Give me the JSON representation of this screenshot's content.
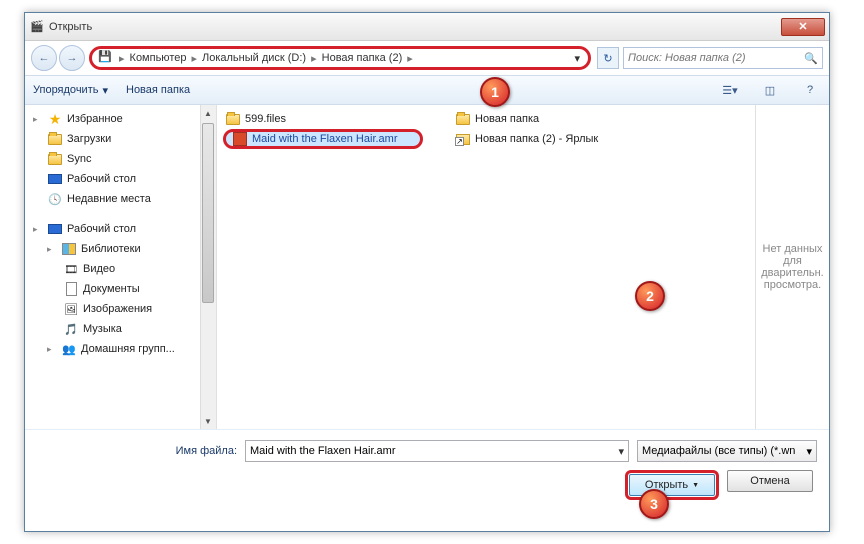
{
  "window": {
    "title": "Открыть"
  },
  "breadcrumb": {
    "parts": [
      "Компьютер",
      "Локальный диск (D:)",
      "Новая папка (2)"
    ]
  },
  "search": {
    "placeholder": "Поиск: Новая папка (2)"
  },
  "toolbar": {
    "organize": "Упорядочить",
    "newfolder": "Новая папка"
  },
  "sidebar": {
    "favorites": "Избранное",
    "downloads": "Загрузки",
    "sync": "Sync",
    "desktop": "Рабочий стол",
    "recent": "Недавние места",
    "desktop2": "Рабочий стол",
    "libraries": "Библиотеки",
    "video": "Видео",
    "documents": "Документы",
    "pictures": "Изображения",
    "music": "Музыка",
    "homegroup": "Домашняя групп..."
  },
  "files": {
    "f1": "599.files",
    "f2": "Maid with the Flaxen Hair.amr",
    "f3": "Новая папка",
    "f4": "Новая папка (2) - Ярлык"
  },
  "preview": {
    "text": "Нет данных для дварительн. просмотра."
  },
  "footer": {
    "label": "Имя файла:",
    "value": "Maid with the Flaxen Hair.amr",
    "filter": "Медиафайлы (все типы) (*.wn",
    "open": "Открыть",
    "cancel": "Отмена"
  },
  "markers": {
    "m1": "1",
    "m2": "2",
    "m3": "3"
  }
}
